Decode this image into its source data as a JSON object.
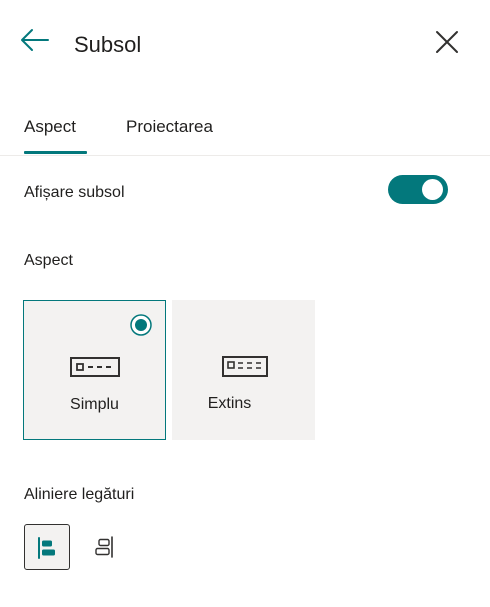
{
  "header": {
    "title": "Subsol",
    "back_icon": "arrow-left-icon",
    "close_icon": "close-icon"
  },
  "tabs": [
    {
      "label": "Aspect",
      "selected": true
    },
    {
      "label": "Proiectarea",
      "selected": false
    }
  ],
  "footer_toggle": {
    "label": "Afișare subsol",
    "on": true
  },
  "layout": {
    "label": "Aspect",
    "options": [
      {
        "label": "Simplu",
        "icon": "footer-simple-icon",
        "selected": true
      },
      {
        "label": "Extins",
        "icon": "footer-extended-icon",
        "selected": false
      }
    ]
  },
  "alignment": {
    "label": "Aliniere legături",
    "options": [
      {
        "icon": "align-left-icon",
        "selected": true
      },
      {
        "icon": "align-right-icon",
        "selected": false
      }
    ]
  },
  "colors": {
    "accent": "#03787c",
    "card_bg": "#f3f2f1",
    "text": "#201f1e"
  }
}
